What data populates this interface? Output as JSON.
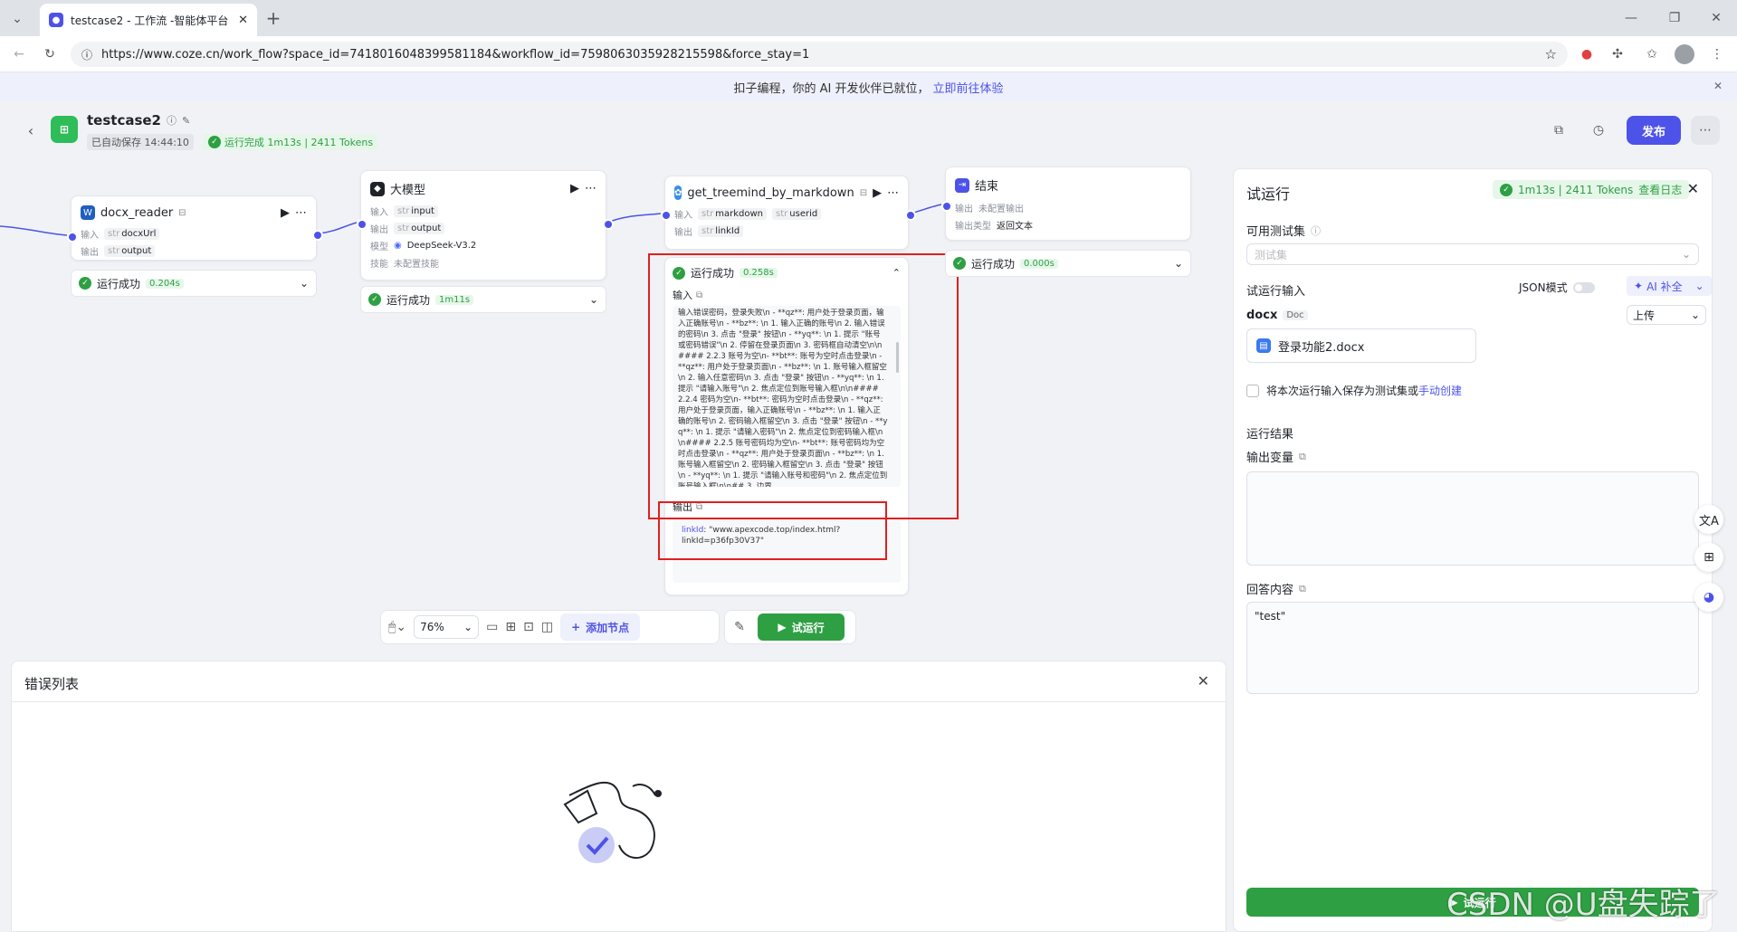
{
  "browser": {
    "tab_title": "testcase2 - 工作流 -智能体平台",
    "url": "https://www.coze.cn/work_flow?space_id=7418016048399581184&workflow_id=7598063035928215598&force_stay=1"
  },
  "banner": {
    "text": "扣子编程，你的 AI 开发伙伴已就位，",
    "link": "立即前往体验"
  },
  "header": {
    "title": "testcase2",
    "autosave": "已自动保存 14:44:10",
    "run_status": "运行完成 1m13s | 2411 Tokens",
    "publish": "发布"
  },
  "nodes": {
    "docx_reader": {
      "title": "docx_reader",
      "in_label": "输入",
      "in_type": "str",
      "in_val": "docxUrl",
      "out_label": "输出",
      "out_type": "str",
      "out_val": "output",
      "status": "运行成功",
      "time": "0.204s"
    },
    "llm": {
      "title": "大模型",
      "in_label": "输入",
      "in_type": "str",
      "in_val": "input",
      "out_label": "输出",
      "out_type": "str",
      "out_val": "output",
      "model_label": "模型",
      "model_val": "DeepSeek-V3.2",
      "skill_label": "技能",
      "skill_val": "未配置技能",
      "status": "运行成功",
      "time": "1m11s"
    },
    "treemind": {
      "title": "get_treemind_by_markdown",
      "in_label": "输入",
      "in_type1": "str",
      "in_val1": "markdown",
      "in_type2": "str",
      "in_val2": "userid",
      "out_label": "输出",
      "out_type": "str",
      "out_val": "linkId",
      "status": "运行成功",
      "time": "0.258s",
      "input_title": "输入",
      "input_text": "输入错误密码，登录失败\\n - **qz**: 用户处于登录页面，输入正确账号\\n - **bz**: \\n 1. 输入正确的账号\\n 2. 输入错误的密码\\n 3. 点击 \"登录\" 按钮\\n - **yq**: \\n 1. 提示 \"账号或密码错误\"\\n 2. 停留在登录页面\\n 3. 密码框自动清空\\n\\n#### 2.2.3 账号为空\\n- **bt**: 账号为空时点击登录\\n - **qz**: 用户处于登录页面\\n - **bz**: \\n 1. 账号输入框留空\\n 2. 输入任意密码\\n 3. 点击 \"登录\" 按钮\\n - **yq**: \\n 1. 提示 \"请输入账号\"\\n 2. 焦点定位到账号输入框\\n\\n#### 2.2.4 密码为空\\n- **bt**: 密码为空时点击登录\\n - **qz**: 用户处于登录页面，输入正确账号\\n - **bz**: \\n 1. 输入正确的账号\\n 2. 密码输入框留空\\n 3. 点击 \"登录\" 按钮\\n - **yq**: \\n 1. 提示 \"请输入密码\"\\n 2. 焦点定位到密码输入框\\n\\n#### 2.2.5 账号密码均为空\\n- **bt**: 账号密码均为空时点击登录\\n - **qz**: 用户处于登录页面\\n - **bz**: \\n 1. 账号输入框留空\\n 2. 密码输入框留空\\n 3. 点击 \"登录\" 按钮\\n - **yq**: \\n 1. 提示 \"请输入账号和密码\"\\n 2. 焦点定位到账号输入框\\n\\n## 3. 边界",
      "output_title": "输出",
      "output_key": "linkId",
      "output_val": ": \"www.apexcode.top/index.html?linkId=p36fp30V37\""
    },
    "end": {
      "title": "结束",
      "out_label": "输出",
      "out_val": "未配置输出",
      "type_label": "输出类型",
      "type_val": "返回文本",
      "status": "运行成功",
      "time": "0.000s"
    }
  },
  "toolbar": {
    "zoom": "76%",
    "add_node": "添加节点",
    "test_run": "试运行"
  },
  "error_panel": {
    "title": "错误列表"
  },
  "run_panel": {
    "title": "试运行",
    "status": "1m13s | 2411 Tokens",
    "view_log": "查看日志",
    "testset_label": "可用测试集",
    "testset_placeholder": "测试集",
    "input_label": "试运行输入",
    "json_mode": "JSON模式",
    "ai_fill": "AI 补全",
    "docx_label": "docx",
    "docx_type": "Doc",
    "upload_select": "上传",
    "file_name": "登录功能2.docx",
    "save_checkbox": "将本次运行输入保存为测试集或",
    "save_link": "手动创建",
    "result_label": "运行结果",
    "output_var_label": "输出变量",
    "answer_label": "回答内容",
    "answer_value": "\"test\"",
    "run_button": "试运行"
  },
  "watermark": "CSDN @U盘失踪了"
}
